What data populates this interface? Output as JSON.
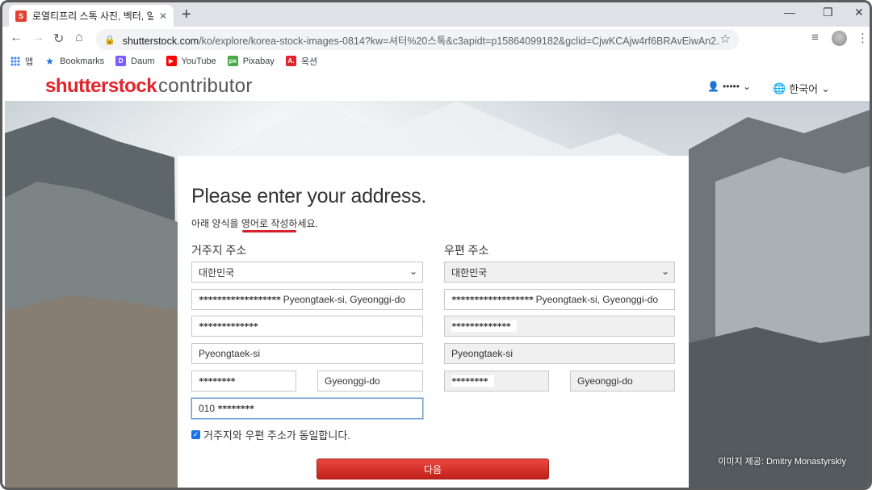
{
  "browser": {
    "tab_title": "로열티프리 스톡 사진, 벡터, 일러",
    "tab_close": "✕",
    "new_tab": "+",
    "win_min": "—",
    "win_max": "❐",
    "win_close": "✕",
    "url_host": "shutterstock.com",
    "url_rest": "/ko/explore/korea-stock-images-0814?kw=셔터%20스톡&c3apidt=p15864099182&gclid=CjwKCAjw4rf6BRAvEiwAn2...",
    "star": "☆"
  },
  "bookmarks": [
    {
      "label": "앱",
      "icon": "apps-grid-icon"
    },
    {
      "label": "Bookmarks",
      "icon": "star-icon",
      "color": "#1a73e8"
    },
    {
      "label": "Daum",
      "icon": "daum-icon",
      "color": "#7a5cff"
    },
    {
      "label": "YouTube",
      "icon": "youtube-icon",
      "color": "#ff0000"
    },
    {
      "label": "Pixabay",
      "icon": "pixabay-icon",
      "color": "#48a947"
    },
    {
      "label": "옥션",
      "icon": "auction-icon",
      "color": "#e3232c"
    }
  ],
  "header": {
    "logo_main": "shutterstock",
    "logo_sub": "contributor",
    "user_masked": "•••••",
    "language": "한국어"
  },
  "form": {
    "title": "Please enter your address.",
    "subtitle": "아래 양식을 영어로 작성하세요.",
    "residence_heading": "거주지 주소",
    "postal_heading": "우편 주소",
    "residence": {
      "country": "대한민국",
      "address1_mask": "******************",
      "address1_tail": "Pyeongtaek-si, Gyeonggi-do",
      "address2_mask": "*************",
      "city": "Pyeongtaek-si",
      "postcode_mask": "********",
      "state": "Gyeonggi-do",
      "phone_prefix": "010",
      "phone_mask": "********"
    },
    "postal": {
      "country": "대한민국",
      "address1_mask": "******************",
      "address1_tail": "Pyeongtaek-si, Gyeonggi-do",
      "address2_mask": "*************",
      "city": "Pyeongtaek-si",
      "postcode_mask": "********",
      "state": "Gyeonggi-do"
    },
    "same_address_label": "거주지와 우편 주소가 동일합니다.",
    "same_address_checked": true,
    "next_button": "다음"
  },
  "image_credit": "이미지 제공: Dmitry Monastyrskiy",
  "colors": {
    "brand_red": "#e3232c",
    "button_red": "#c2201a",
    "underline_red": "#d8202a"
  }
}
